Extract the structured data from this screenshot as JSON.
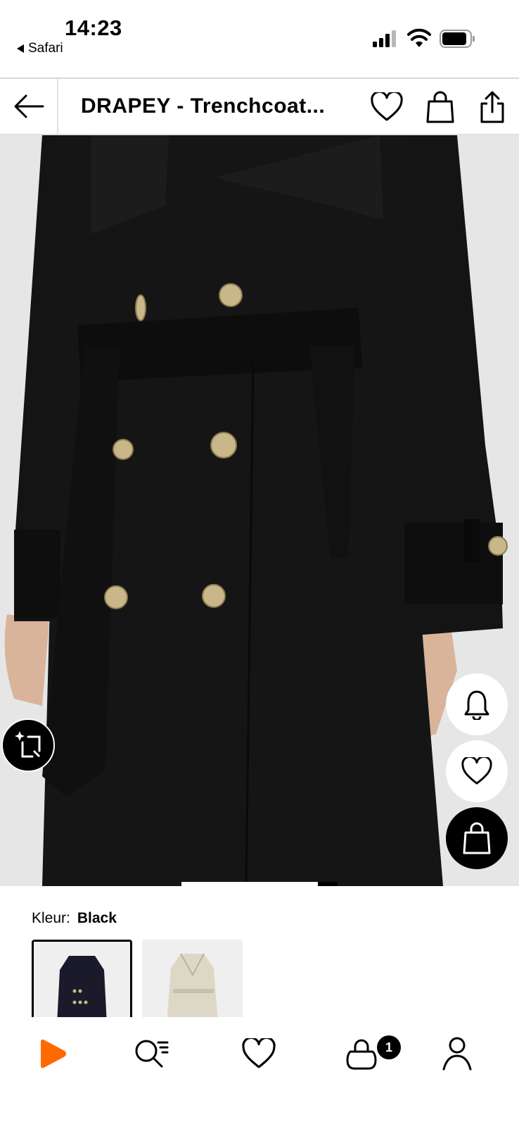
{
  "status_bar": {
    "time": "14:23",
    "back_app": "Safari",
    "icons": [
      "cellular-signal-icon",
      "wifi-icon",
      "battery-icon"
    ]
  },
  "header": {
    "title": "DRAPEY - Trenchcoat...",
    "icons": [
      "back-arrow-icon",
      "heart-icon",
      "shopping-bag-icon",
      "share-icon"
    ]
  },
  "product_image": {
    "icons": [
      "ai-lookalike-icon",
      "bell-icon",
      "heart-icon",
      "shopping-bag-icon"
    ]
  },
  "color": {
    "label": "Kleur:",
    "value": "Black",
    "swatches": [
      "black-trenchcoat-thumbnail",
      "beige-trenchcoat-thumbnail"
    ]
  },
  "bottom_nav": {
    "items": [
      "home-logo-icon",
      "search-icon",
      "wishlist-heart-icon",
      "bag-icon",
      "profile-icon"
    ],
    "bag_badge": "1"
  },
  "colors": {
    "brand": "#ff6900",
    "coat": "#141414",
    "buttons": "#c9b78a",
    "background": "#e6e6e6"
  }
}
